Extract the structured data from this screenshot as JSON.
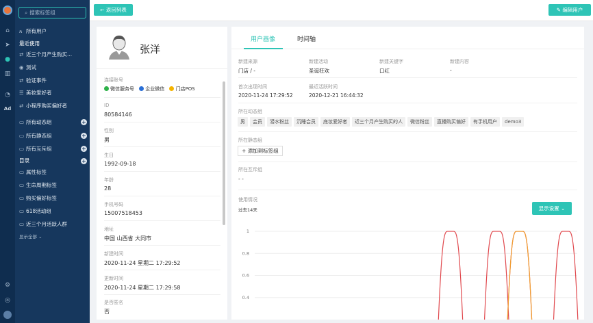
{
  "sidebar": {
    "search_placeholder": "搜索标签组",
    "items": [
      {
        "label": "所有用户",
        "icon": "users-icon"
      },
      {
        "label": "最近使用",
        "icon": ""
      },
      {
        "label": "近三个月产生购买...",
        "icon": "swap-icon"
      },
      {
        "label": "测试",
        "icon": "user-circle-icon"
      },
      {
        "label": "验证事件",
        "icon": "swap-icon"
      },
      {
        "label": "美妆爱好者",
        "icon": "list-icon"
      },
      {
        "label": "小程序购买偏好者",
        "icon": "swap-icon"
      }
    ],
    "groups": [
      {
        "label": "所有动态组"
      },
      {
        "label": "所有静态组"
      },
      {
        "label": "所有互斥组"
      }
    ],
    "catalog_title": "目录",
    "catalog_items": [
      "属性标签",
      "生命周期标签",
      "购买偏好标签",
      "618活动组",
      "近三个月活跃人群"
    ],
    "show_all": "显示全部"
  },
  "toolbar": {
    "back_label": "返回列表",
    "edit_label": "编辑用户"
  },
  "profile": {
    "name": "张洋",
    "channels_label": "连接账号",
    "channels": [
      "微信服务号",
      "企业微信",
      "门店POS"
    ],
    "fields": [
      {
        "label": "ID",
        "value": "80584146"
      },
      {
        "label": "性别",
        "value": "男"
      },
      {
        "label": "生日",
        "value": "1992-09-18"
      },
      {
        "label": "年龄",
        "value": "28"
      },
      {
        "label": "手机号码",
        "value": "15007518453"
      },
      {
        "label": "地址",
        "value": "中国 山西省 大同市"
      },
      {
        "label": "新建时间",
        "value": "2020-11-24 星期二 17:29:52"
      },
      {
        "label": "更新时间",
        "value": "2020-11-24 星期二 17:29:58"
      },
      {
        "label": "是否匿名",
        "value": "否"
      }
    ]
  },
  "tabs": [
    {
      "label": "用户画像"
    },
    {
      "label": "时间轴"
    }
  ],
  "portrait": {
    "row1": [
      {
        "label": "新建来源",
        "value": "门店 / -"
      },
      {
        "label": "新建活动",
        "value": "圣诞狂欢"
      },
      {
        "label": "新建关键字",
        "value": "口红"
      },
      {
        "label": "新建内容",
        "value": "-"
      }
    ],
    "row2": [
      {
        "label": "首次出现时间",
        "value": "2020-11-24 17:29:52"
      },
      {
        "label": "最近活跃时间",
        "value": "2020-12-21 16:44:32"
      }
    ],
    "dynamic_label": "所在动态组",
    "dynamic_tags": [
      "男",
      "会员",
      "潜水粉丝",
      "沉睡会员",
      "底妆爱好者",
      "近三个月产生购买的人",
      "微信粉丝",
      "直播购买偏好",
      "有手机用户",
      "demo3"
    ],
    "static_label": "所在静态组",
    "add_group_label": "添加到标签组",
    "mutex_label": "所在互斥组",
    "mutex_value": "- -",
    "usage_label": "使用情况",
    "period_label": "过去14天",
    "display_settings": "显示设置"
  },
  "colors": {
    "accent": "#2ec4b6",
    "sidebar": "#16375d",
    "rail": "#0f2d4f",
    "line_red": "#e0474c",
    "line_orange": "#f0a030"
  },
  "chart_data": {
    "type": "line",
    "yticks": [
      1,
      0.8,
      0.6,
      0.4
    ],
    "ylim": [
      0.2,
      1.05
    ],
    "x": [
      0,
      1,
      2,
      3,
      4,
      5,
      6,
      7,
      8,
      9,
      10,
      11,
      12,
      13
    ],
    "series": [
      {
        "color": "#e0474c",
        "values": [
          0,
          0,
          0,
          0,
          0,
          0,
          0,
          0,
          1,
          0,
          1,
          1,
          0,
          1
        ]
      },
      {
        "color": "#f0a030",
        "values": [
          0,
          0,
          0,
          0,
          0,
          0,
          0,
          0,
          0,
          0,
          0,
          1,
          0,
          0
        ]
      }
    ]
  }
}
